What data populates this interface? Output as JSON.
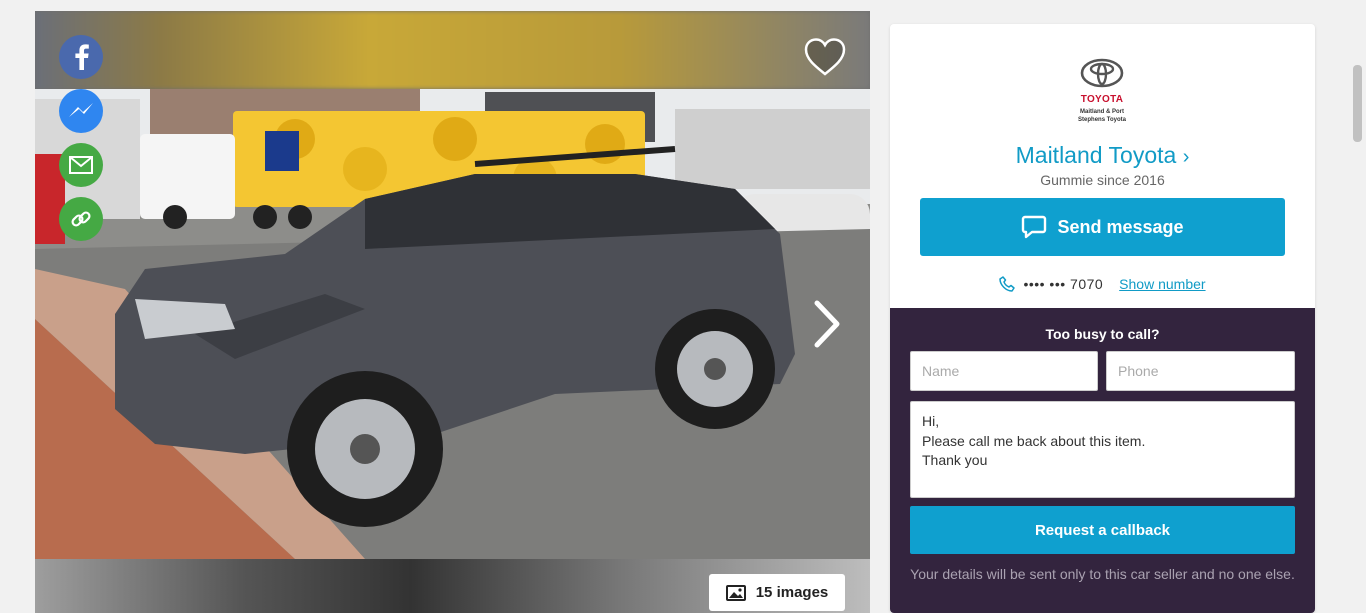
{
  "gallery": {
    "image_alt": "Grey Toyota Fortuner SUV",
    "image_count_label": "15 images",
    "share": [
      "facebook-icon",
      "messenger-icon",
      "mail-icon",
      "link-icon"
    ],
    "favourite_icon": "heart-icon",
    "next_icon": "chevron-right-icon"
  },
  "seller": {
    "logo_brand": "TOYOTA",
    "logo_dealer": "Maitland & Port Stephens Toyota",
    "name": "Maitland Toyota",
    "since": "Gummie since 2016",
    "send_message_label": "Send message",
    "phone_masked": "•••• ••• 7070",
    "show_number_label": "Show number"
  },
  "callback": {
    "title": "Too busy to call?",
    "name_placeholder": "Name",
    "phone_placeholder": "Phone",
    "message": "Hi,\nPlease call me back about this item.\nThank you",
    "button_label": "Request a callback",
    "note": "Your details will be sent only to this car seller and no one else."
  },
  "colors": {
    "accent": "#0fa0cf",
    "link": "#119bc6",
    "callback_bg": "#33243e",
    "facebook": "#4a69ad",
    "messenger": "#2f86f0",
    "share_green": "#45a944"
  }
}
